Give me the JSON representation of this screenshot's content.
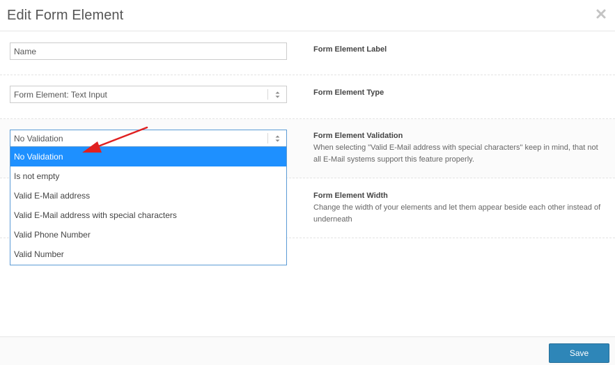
{
  "modal": {
    "title": "Edit Form Element",
    "close_icon": "close-icon"
  },
  "fields": {
    "label": {
      "input_value": "Name",
      "title": "Form Element Label"
    },
    "type": {
      "selected": "Form Element: Text Input",
      "title": "Form Element Type"
    },
    "validation": {
      "selected": "No Validation",
      "title": "Form Element Validation",
      "description": "When selecting \"Valid E-Mail address with special characters\" keep in mind, that not all E-Mail systems support this feature properly.",
      "options": [
        "No Validation",
        "Is not empty",
        "Valid E-Mail address",
        "Valid E-Mail address with special characters",
        "Valid Phone Number",
        "Valid Number"
      ],
      "highlighted_option": "No Validation"
    },
    "width": {
      "title": "Form Element Width",
      "description": "Change the width of your elements and let them appear beside each other instead of underneath"
    }
  },
  "footer": {
    "save_label": "Save"
  },
  "colors": {
    "accent": "#1e90ff",
    "save_button": "#2e86b8",
    "annotation_arrow": "#e02020"
  }
}
